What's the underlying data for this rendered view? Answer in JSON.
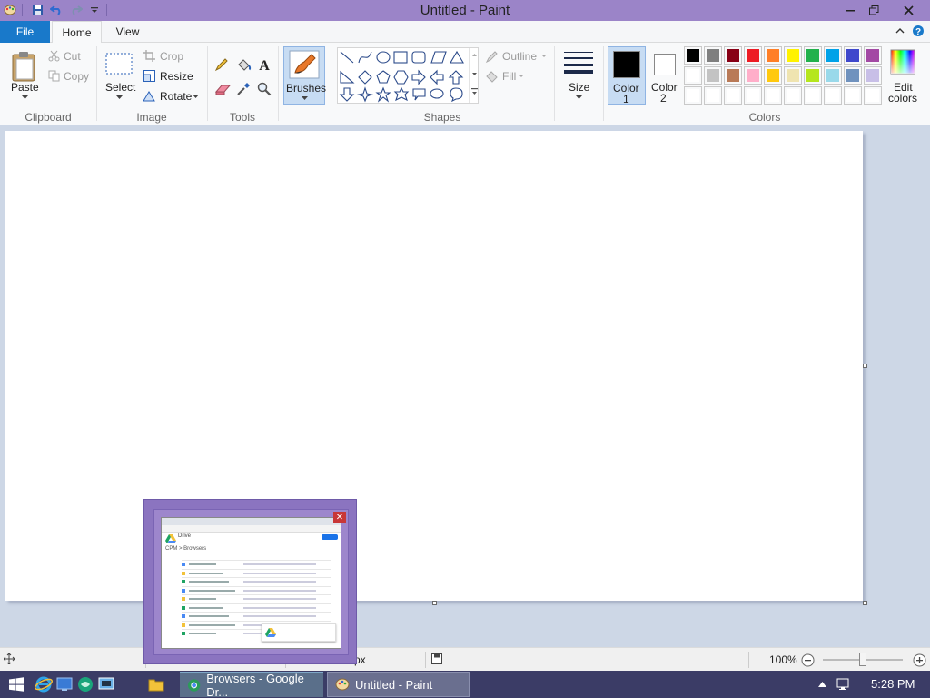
{
  "window": {
    "title": "Untitled - Paint",
    "minimize": "—",
    "restore": "❐",
    "close": "✕"
  },
  "quick_access": [
    "app-icon",
    "save-icon",
    "undo-icon",
    "redo-icon",
    "customize-icon"
  ],
  "tabs": {
    "file": "File",
    "home": "Home",
    "view": "View"
  },
  "ribbon": {
    "clipboard": {
      "paste": "Paste",
      "cut": "Cut",
      "copy": "Copy",
      "label": "Clipboard"
    },
    "image": {
      "select": "Select",
      "crop": "Crop",
      "resize": "Resize",
      "rotate": "Rotate",
      "label": "Image"
    },
    "tools": {
      "label": "Tools"
    },
    "brushes": {
      "label": "Brushes"
    },
    "shapes": {
      "outline": "Outline",
      "fill": "Fill",
      "label": "Shapes"
    },
    "size": {
      "label": "Size"
    },
    "color1": {
      "label1": "Color",
      "label2": "1"
    },
    "color2": {
      "label1": "Color",
      "label2": "2"
    },
    "colors": {
      "label": "Colors",
      "edit_label1": "Edit",
      "edit_label2": "colors",
      "color1_value": "#000000",
      "color2_value": "#ffffff",
      "palette_row1": [
        "#000000",
        "#7f7f7f",
        "#880015",
        "#ed1c24",
        "#ff7f27",
        "#fff200",
        "#22b14c",
        "#00a2e8",
        "#3f48cc",
        "#a349a4"
      ],
      "palette_row2": [
        "#ffffff",
        "#c3c3c3",
        "#b97a57",
        "#ffaec9",
        "#ffc90e",
        "#efe4b0",
        "#b5e61d",
        "#99d9ea",
        "#7092be",
        "#c8bfe7"
      ],
      "palette_row3": [
        "#ffffff",
        "#ffffff",
        "#ffffff",
        "#ffffff",
        "#ffffff",
        "#ffffff",
        "#ffffff",
        "#ffffff",
        "#ffffff",
        "#ffffff"
      ]
    }
  },
  "statusbar": {
    "size_suffix": "px",
    "zoom": "100%"
  },
  "taskbar": {
    "items": [
      {
        "label": "Browsers - Google Dr..."
      },
      {
        "label": "Untitled - Paint"
      }
    ],
    "time": "5:28 PM"
  },
  "thumbnail": {
    "breadcrumb": "CPM   >   Browsers",
    "drive": "Drive"
  }
}
